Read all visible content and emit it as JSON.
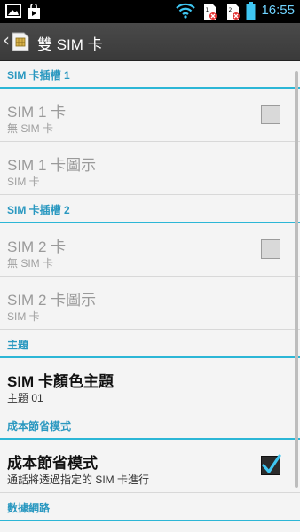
{
  "status_bar": {
    "time": "16:55"
  },
  "app_bar": {
    "title": "雙 SIM 卡"
  },
  "sections": {
    "slot1": "SIM 卡插槽 1",
    "slot2": "SIM 卡插槽 2",
    "theme": "主題",
    "power": "成本節省模式",
    "data": "數據網路"
  },
  "items": {
    "sim1": {
      "title": "SIM 1 卡",
      "summary": "無 SIM 卡",
      "checked": false
    },
    "sim1_icon": {
      "title": "SIM 1 卡圖示",
      "summary": "SIM 卡"
    },
    "sim2": {
      "title": "SIM 2 卡",
      "summary": "無 SIM 卡",
      "checked": false
    },
    "sim2_icon": {
      "title": "SIM 2 卡圖示",
      "summary": "SIM 卡"
    },
    "color_theme": {
      "title": "SIM 卡顏色主題",
      "summary": "主題 01"
    },
    "cost_saving": {
      "title": "成本節省模式",
      "summary": "通話將透過指定的 SIM 卡進行",
      "checked": true
    }
  }
}
